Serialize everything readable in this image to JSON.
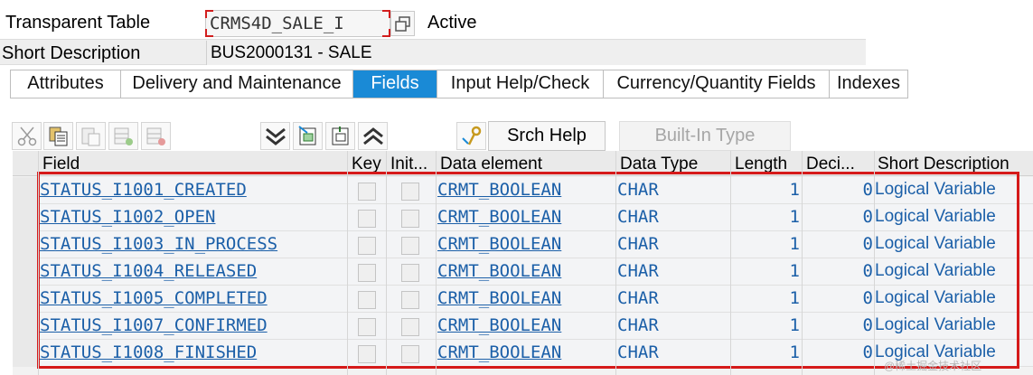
{
  "header": {
    "object_type_label": "Transparent Table",
    "table_name": "CRMS4D_SALE_I",
    "status": "Active",
    "short_desc_label": "Short Description",
    "short_desc_value": "BUS2000131 - SALE"
  },
  "tabs": [
    {
      "label": "Attributes",
      "active": false
    },
    {
      "label": "Delivery and Maintenance",
      "active": false
    },
    {
      "label": "Fields",
      "active": true
    },
    {
      "label": "Input Help/Check",
      "active": false
    },
    {
      "label": "Currency/Quantity Fields",
      "active": false
    },
    {
      "label": "Indexes",
      "active": false
    }
  ],
  "toolbar": {
    "icons": [
      "cut-icon",
      "copy-icon",
      "paste-icon",
      "insert-row-icon",
      "delete-row-icon",
      "collapse-all-icon",
      "insert-field-icon",
      "include-icon",
      "expand-all-icon",
      "search-help-icon"
    ],
    "srch_help_label": "Srch Help",
    "builtin_type_label": "Built-In Type"
  },
  "table": {
    "columns": [
      "Field",
      "Key",
      "Init...",
      "Data element",
      "Data Type",
      "Length",
      "Deci...",
      "Short Description"
    ],
    "rows": [
      {
        "field": "STATUS_I1001_CREATED",
        "data_element": "CRMT_BOOLEAN",
        "data_type": "CHAR",
        "length": "1",
        "decimals": "0",
        "description": "Logical Variable"
      },
      {
        "field": "STATUS_I1002_OPEN",
        "data_element": "CRMT_BOOLEAN",
        "data_type": "CHAR",
        "length": "1",
        "decimals": "0",
        "description": "Logical Variable"
      },
      {
        "field": "STATUS_I1003_IN_PROCESS",
        "data_element": "CRMT_BOOLEAN",
        "data_type": "CHAR",
        "length": "1",
        "decimals": "0",
        "description": "Logical Variable"
      },
      {
        "field": "STATUS_I1004_RELEASED",
        "data_element": "CRMT_BOOLEAN",
        "data_type": "CHAR",
        "length": "1",
        "decimals": "0",
        "description": "Logical Variable"
      },
      {
        "field": "STATUS_I1005_COMPLETED",
        "data_element": "CRMT_BOOLEAN",
        "data_type": "CHAR",
        "length": "1",
        "decimals": "0",
        "description": "Logical Variable"
      },
      {
        "field": "STATUS_I1007_CONFIRMED",
        "data_element": "CRMT_BOOLEAN",
        "data_type": "CHAR",
        "length": "1",
        "decimals": "0",
        "description": "Logical Variable"
      },
      {
        "field": "STATUS_I1008_FINISHED",
        "data_element": "CRMT_BOOLEAN",
        "data_type": "CHAR",
        "length": "1",
        "decimals": "0",
        "description": "Logical Variable"
      }
    ]
  },
  "watermark": "@稀土掘金技术社区",
  "colors": {
    "accent": "#1a8ad6",
    "link": "#1b5fa8",
    "highlight": "#d51a1a"
  }
}
